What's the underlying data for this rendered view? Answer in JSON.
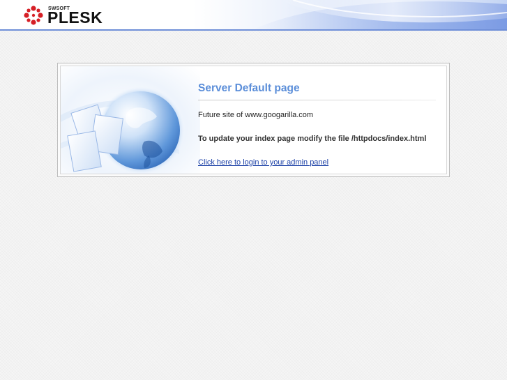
{
  "header": {
    "brand_small": "SWSOFT",
    "brand_name": "PLESK",
    "accent_color": "#6f8fd8"
  },
  "panel": {
    "title": "Server Default page",
    "future_site_text": "Future site of www.googarilla.com",
    "update_instructions": "To update your index page modify the file /httpdocs/index.html",
    "admin_link_text": "Click here to login to your admin panel",
    "title_color": "#5b8ed9",
    "link_color": "#1a3fa6",
    "illustration": "globe-with-documents-icon"
  }
}
